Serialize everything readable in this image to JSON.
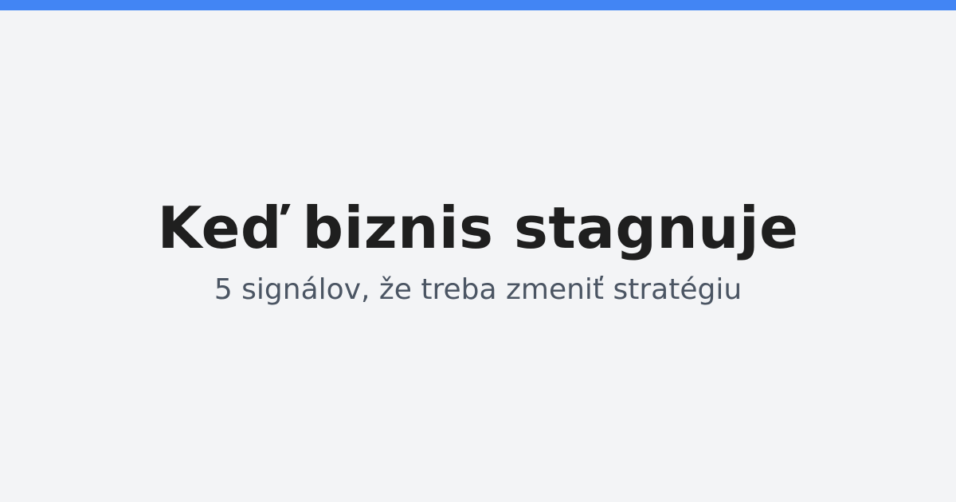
{
  "header": {
    "title": "Keď biznis stagnuje",
    "subtitle": "5 signálov, že treba zmeniť stratégiu"
  },
  "colors": {
    "accent": "#4285f4",
    "background": "#f3f4f6",
    "title": "#1f1f1f",
    "subtitle": "#4b5563"
  }
}
